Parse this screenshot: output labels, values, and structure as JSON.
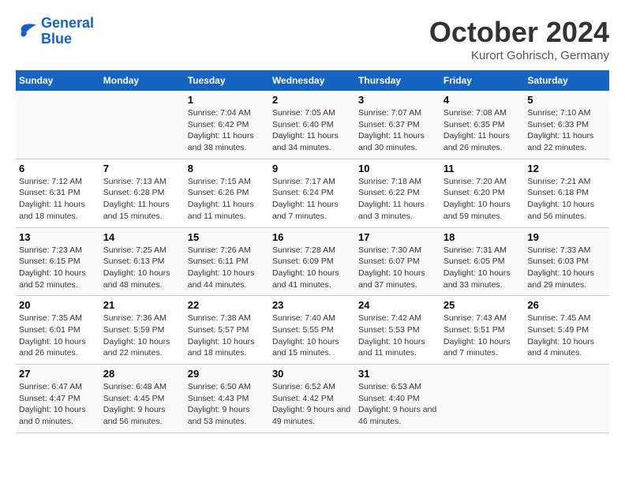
{
  "header": {
    "logo_line1": "General",
    "logo_line2": "Blue",
    "month_title": "October 2024",
    "location": "Kurort Gohrisch, Germany"
  },
  "weekdays": [
    "Sunday",
    "Monday",
    "Tuesday",
    "Wednesday",
    "Thursday",
    "Friday",
    "Saturday"
  ],
  "weeks": [
    [
      {
        "day": "",
        "sunrise": "",
        "sunset": "",
        "daylight": ""
      },
      {
        "day": "",
        "sunrise": "",
        "sunset": "",
        "daylight": ""
      },
      {
        "day": "1",
        "sunrise": "Sunrise: 7:04 AM",
        "sunset": "Sunset: 6:42 PM",
        "daylight": "Daylight: 11 hours and 38 minutes."
      },
      {
        "day": "2",
        "sunrise": "Sunrise: 7:05 AM",
        "sunset": "Sunset: 6:40 PM",
        "daylight": "Daylight: 11 hours and 34 minutes."
      },
      {
        "day": "3",
        "sunrise": "Sunrise: 7:07 AM",
        "sunset": "Sunset: 6:37 PM",
        "daylight": "Daylight: 11 hours and 30 minutes."
      },
      {
        "day": "4",
        "sunrise": "Sunrise: 7:08 AM",
        "sunset": "Sunset: 6:35 PM",
        "daylight": "Daylight: 11 hours and 26 minutes."
      },
      {
        "day": "5",
        "sunrise": "Sunrise: 7:10 AM",
        "sunset": "Sunset: 6:33 PM",
        "daylight": "Daylight: 11 hours and 22 minutes."
      }
    ],
    [
      {
        "day": "6",
        "sunrise": "Sunrise: 7:12 AM",
        "sunset": "Sunset: 6:31 PM",
        "daylight": "Daylight: 11 hours and 18 minutes."
      },
      {
        "day": "7",
        "sunrise": "Sunrise: 7:13 AM",
        "sunset": "Sunset: 6:28 PM",
        "daylight": "Daylight: 11 hours and 15 minutes."
      },
      {
        "day": "8",
        "sunrise": "Sunrise: 7:15 AM",
        "sunset": "Sunset: 6:26 PM",
        "daylight": "Daylight: 11 hours and 11 minutes."
      },
      {
        "day": "9",
        "sunrise": "Sunrise: 7:17 AM",
        "sunset": "Sunset: 6:24 PM",
        "daylight": "Daylight: 11 hours and 7 minutes."
      },
      {
        "day": "10",
        "sunrise": "Sunrise: 7:18 AM",
        "sunset": "Sunset: 6:22 PM",
        "daylight": "Daylight: 11 hours and 3 minutes."
      },
      {
        "day": "11",
        "sunrise": "Sunrise: 7:20 AM",
        "sunset": "Sunset: 6:20 PM",
        "daylight": "Daylight: 10 hours and 59 minutes."
      },
      {
        "day": "12",
        "sunrise": "Sunrise: 7:21 AM",
        "sunset": "Sunset: 6:18 PM",
        "daylight": "Daylight: 10 hours and 56 minutes."
      }
    ],
    [
      {
        "day": "13",
        "sunrise": "Sunrise: 7:23 AM",
        "sunset": "Sunset: 6:15 PM",
        "daylight": "Daylight: 10 hours and 52 minutes."
      },
      {
        "day": "14",
        "sunrise": "Sunrise: 7:25 AM",
        "sunset": "Sunset: 6:13 PM",
        "daylight": "Daylight: 10 hours and 48 minutes."
      },
      {
        "day": "15",
        "sunrise": "Sunrise: 7:26 AM",
        "sunset": "Sunset: 6:11 PM",
        "daylight": "Daylight: 10 hours and 44 minutes."
      },
      {
        "day": "16",
        "sunrise": "Sunrise: 7:28 AM",
        "sunset": "Sunset: 6:09 PM",
        "daylight": "Daylight: 10 hours and 41 minutes."
      },
      {
        "day": "17",
        "sunrise": "Sunrise: 7:30 AM",
        "sunset": "Sunset: 6:07 PM",
        "daylight": "Daylight: 10 hours and 37 minutes."
      },
      {
        "day": "18",
        "sunrise": "Sunrise: 7:31 AM",
        "sunset": "Sunset: 6:05 PM",
        "daylight": "Daylight: 10 hours and 33 minutes."
      },
      {
        "day": "19",
        "sunrise": "Sunrise: 7:33 AM",
        "sunset": "Sunset: 6:03 PM",
        "daylight": "Daylight: 10 hours and 29 minutes."
      }
    ],
    [
      {
        "day": "20",
        "sunrise": "Sunrise: 7:35 AM",
        "sunset": "Sunset: 6:01 PM",
        "daylight": "Daylight: 10 hours and 26 minutes."
      },
      {
        "day": "21",
        "sunrise": "Sunrise: 7:36 AM",
        "sunset": "Sunset: 5:59 PM",
        "daylight": "Daylight: 10 hours and 22 minutes."
      },
      {
        "day": "22",
        "sunrise": "Sunrise: 7:38 AM",
        "sunset": "Sunset: 5:57 PM",
        "daylight": "Daylight: 10 hours and 18 minutes."
      },
      {
        "day": "23",
        "sunrise": "Sunrise: 7:40 AM",
        "sunset": "Sunset: 5:55 PM",
        "daylight": "Daylight: 10 hours and 15 minutes."
      },
      {
        "day": "24",
        "sunrise": "Sunrise: 7:42 AM",
        "sunset": "Sunset: 5:53 PM",
        "daylight": "Daylight: 10 hours and 11 minutes."
      },
      {
        "day": "25",
        "sunrise": "Sunrise: 7:43 AM",
        "sunset": "Sunset: 5:51 PM",
        "daylight": "Daylight: 10 hours and 7 minutes."
      },
      {
        "day": "26",
        "sunrise": "Sunrise: 7:45 AM",
        "sunset": "Sunset: 5:49 PM",
        "daylight": "Daylight: 10 hours and 4 minutes."
      }
    ],
    [
      {
        "day": "27",
        "sunrise": "Sunrise: 6:47 AM",
        "sunset": "Sunset: 4:47 PM",
        "daylight": "Daylight: 10 hours and 0 minutes."
      },
      {
        "day": "28",
        "sunrise": "Sunrise: 6:48 AM",
        "sunset": "Sunset: 4:45 PM",
        "daylight": "Daylight: 9 hours and 56 minutes."
      },
      {
        "day": "29",
        "sunrise": "Sunrise: 6:50 AM",
        "sunset": "Sunset: 4:43 PM",
        "daylight": "Daylight: 9 hours and 53 minutes."
      },
      {
        "day": "30",
        "sunrise": "Sunrise: 6:52 AM",
        "sunset": "Sunset: 4:42 PM",
        "daylight": "Daylight: 9 hours and 49 minutes."
      },
      {
        "day": "31",
        "sunrise": "Sunrise: 6:53 AM",
        "sunset": "Sunset: 4:40 PM",
        "daylight": "Daylight: 9 hours and 46 minutes."
      },
      {
        "day": "",
        "sunrise": "",
        "sunset": "",
        "daylight": ""
      },
      {
        "day": "",
        "sunrise": "",
        "sunset": "",
        "daylight": ""
      }
    ]
  ]
}
